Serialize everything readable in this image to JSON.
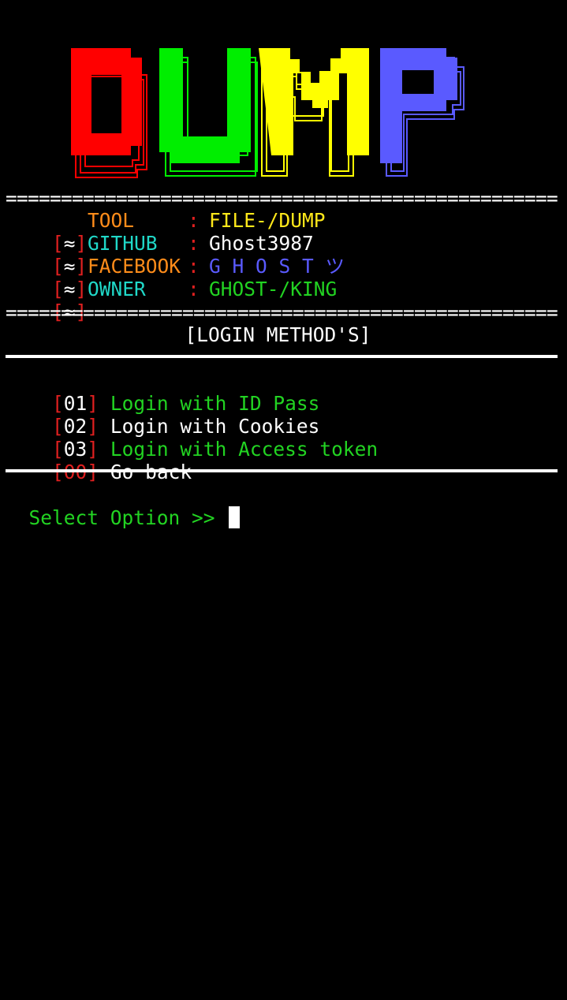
{
  "banner": {
    "letters": [
      "D",
      "U",
      "M",
      "P"
    ],
    "colors": [
      "#ff0000",
      "#00ee00",
      "#ffff00",
      "#5a5aff"
    ]
  },
  "rule_text": "==================================================",
  "info": {
    "bracket_symbol": "≈",
    "rows": [
      {
        "label": "TOOL",
        "value": "FILE-/DUMP",
        "label_color": "#ff8c1a",
        "value_color": "#ffe81a"
      },
      {
        "label": "GITHUB",
        "value": "Ghost3987",
        "label_color": "#20d8c8",
        "value_color": "#ffffff"
      },
      {
        "label": "FACEBOOK",
        "value": "G H O S T ツ",
        "label_color": "#ff8c1a",
        "value_color": "#5a5aff"
      },
      {
        "label": "OWNER",
        "value": "GHOST-/KING",
        "label_color": "#20d8c8",
        "value_color": "#22d322"
      }
    ]
  },
  "login": {
    "title": "[LOGIN METHOD'S]",
    "options": [
      {
        "num": "01",
        "label": "Login with ID Pass",
        "color": "#22d322"
      },
      {
        "num": "02",
        "label": "Login with Cookies",
        "color": "#ffffff"
      },
      {
        "num": "03",
        "label": "Login with Access token",
        "color": "#22d322"
      },
      {
        "num": "00",
        "label": "Go back",
        "color": "#ffffff",
        "num_color": "#e02020"
      }
    ]
  },
  "prompt": {
    "text": "Select Option >> ",
    "color": "#22d322"
  },
  "colors": {
    "bracket": "#e02020",
    "background": "#000000",
    "foreground": "#ffffff"
  }
}
